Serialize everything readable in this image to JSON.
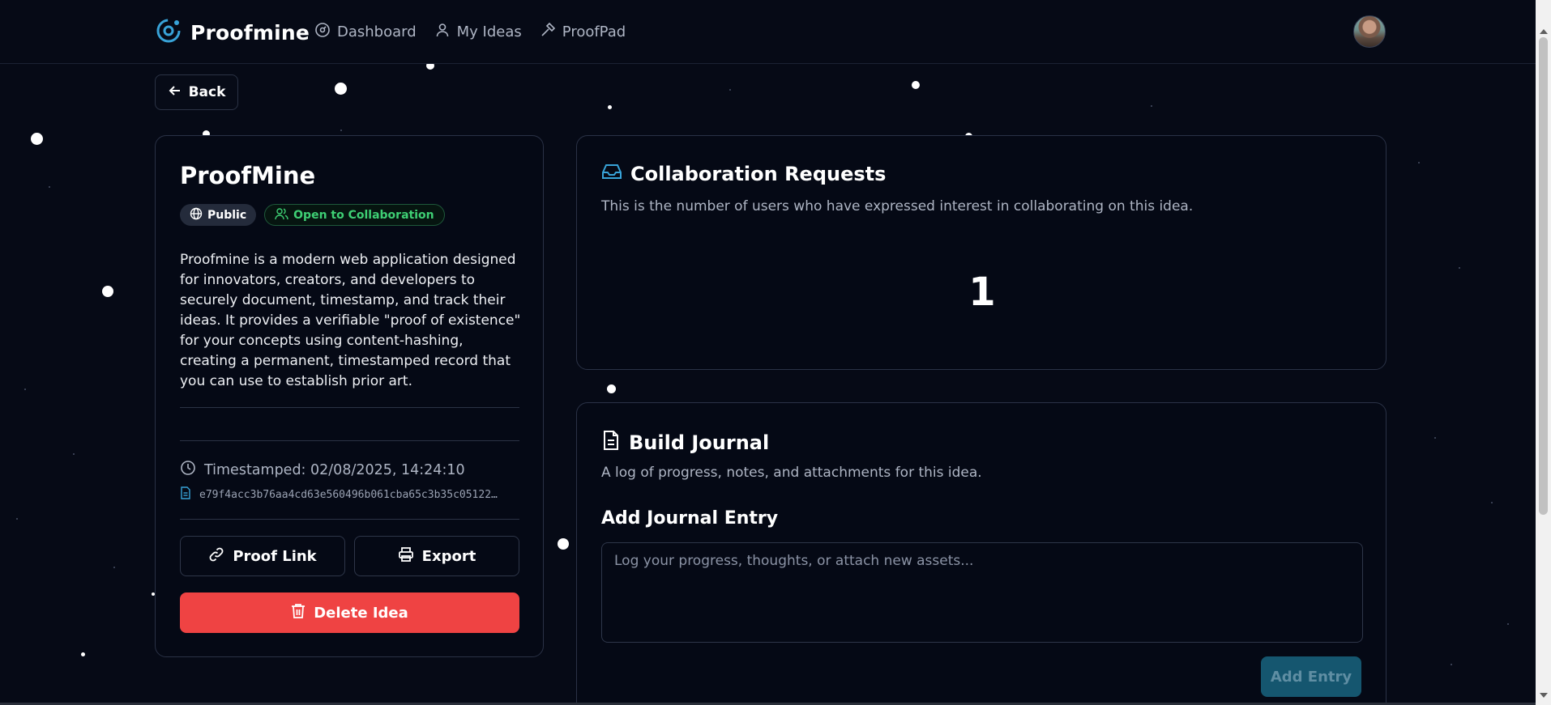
{
  "header": {
    "brand": "Proofmine",
    "nav": [
      {
        "label": "Dashboard",
        "icon": "gauge-icon"
      },
      {
        "label": "My Ideas",
        "icon": "user-icon"
      },
      {
        "label": "ProofPad",
        "icon": "hammer-icon"
      }
    ]
  },
  "back_label": "Back",
  "idea": {
    "title": "ProofMine",
    "badges": {
      "visibility": "Public",
      "collaboration": "Open to Collaboration"
    },
    "description": "Proofmine is a modern web application designed for innovators, creators, and developers to securely document, timestamp, and track their ideas. It provides a verifiable \"proof of existence\" for your concepts using content-hashing, creating a permanent, timestamped record that you can use to establish prior art.",
    "timestamp": "Timestamped: 02/08/2025, 14:24:10",
    "hash": "e79f4acc3b76aa4cd63e560496b061cba65c3b35c05122…",
    "buttons": {
      "proof_link": "Proof Link",
      "export": "Export",
      "delete": "Delete Idea"
    }
  },
  "collaboration": {
    "title": "Collaboration Requests",
    "subtitle": "This is the number of users who have expressed interest in collaborating on this idea.",
    "count": "1"
  },
  "journal": {
    "title": "Build Journal",
    "subtitle": "A log of progress, notes, and attachments for this idea.",
    "add_title": "Add Journal Entry",
    "placeholder": "Log your progress, thoughts, or attach new assets...",
    "add_button": "Add Entry"
  },
  "colors": {
    "background": "#060a16",
    "brand_accent": "#38a3d8",
    "collab_green": "#3ecf74",
    "delete_red": "#ef4343",
    "add_entry_bg": "#15566f"
  }
}
